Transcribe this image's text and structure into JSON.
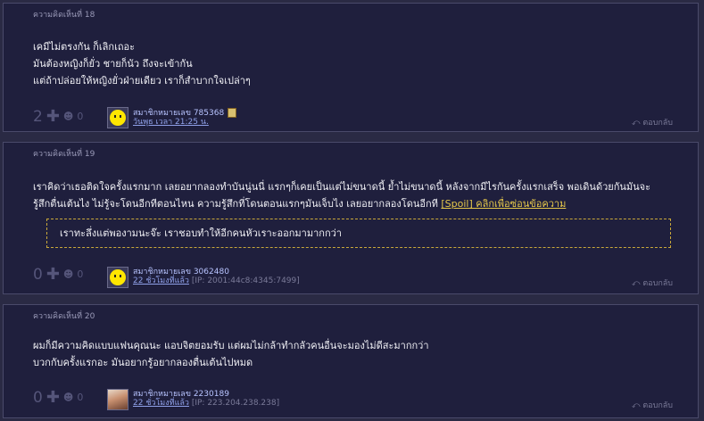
{
  "comments": [
    {
      "header": "ความคิดเห็นที่ 18",
      "lines": [
        "เคมีไม่ตรงกัน ก็เลิกเถอะ",
        "มันต้องหญิงก็ยั่ว ชายก็นัว ถึงจะเข้ากัน",
        "แต่ถ้าปล่อยให้หญิงยั่วฝ่ายเดียว เราก็สำบากใจเปล่าๆ"
      ],
      "votes": "2",
      "emotion_count": "0",
      "member": "สมาชิกหมายเลข 785368",
      "time": "วันพุธ เวลา 21:25 น.",
      "ip": "",
      "reply": "ตอบกลับ",
      "avatar_icon": "smiley"
    },
    {
      "header": "ความคิดเห็นที่ 19",
      "line1": "เราคิดว่าเธอติดใจครั้งแรกมาก เลยอยากลองทำบันนู่นนี่ แรกๆก็เคยเป็นแต่ไม่ขนาดนี้ ย้ำไม่ขนาดนี้ หลังจากมีไรกันครั้งแรกเสร็จ พอเดินด้วยกันมันจะ",
      "line2": "รู้สึกตื่นเต้นไง ไม่รู้จะโดนอีกทีตอนไหน ความรู้สึกที่โดนตอนแรกๆมันเจ็บไง เลยอยากลองโดนอีกที",
      "spoiler_link": "[Spoil] คลิกเพื่อซ่อนข้อความ",
      "spoiler_text": "เราทะลึ่งแต่พองามนะจ๊ะ เราชอบทำให้อีกคนหัวเราะออกมามากกว่า",
      "votes": "0",
      "emotion_count": "0",
      "member": "สมาชิกหมายเลข 3062480",
      "time": "22 ชั่วโมงที่แล้ว",
      "ip": "[IP: 2001:44c8:4345:7499]",
      "reply": "ตอบกลับ",
      "avatar_icon": "smiley"
    },
    {
      "header": "ความคิดเห็นที่ 20",
      "lines": [
        "ผมก็มีความคิดแบบแฟนคุณนะ แอบจิตยอมรับ แต่ผมไม่กล้าทำกลัวคนอื่นจะมองไม่ดีสะมากกว่า",
        "บวกกับครั้งแรกอะ มันอยากรู้อยากลองตื่นเต้นไปหมด"
      ],
      "votes": "0",
      "emotion_count": "0",
      "member": "สมาชิกหมายเลข 2230189",
      "time": "22 ชั่วโมงที่แล้ว",
      "ip": "[IP: 223.204.238.238]",
      "reply": "ตอบกลับ",
      "avatar_icon": "photo"
    }
  ],
  "icons": {
    "plus": "plus-icon",
    "emotion": "emotion-icon",
    "reply": "reply-arrow-icon"
  }
}
